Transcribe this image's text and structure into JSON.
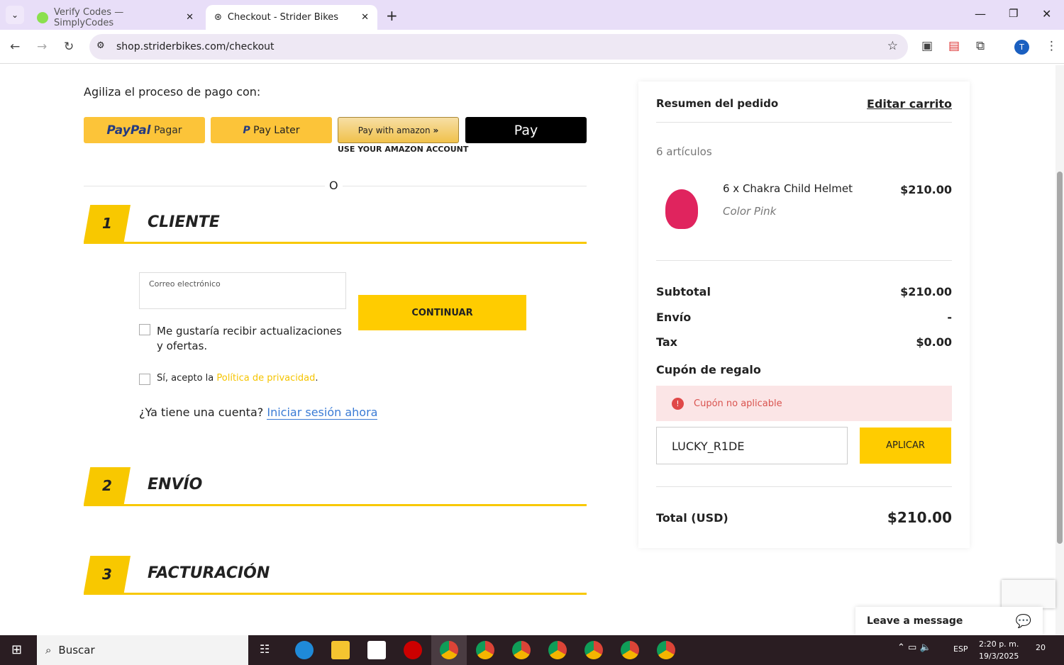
{
  "browser": {
    "tabs": [
      {
        "title": "Verify Codes — SimplyCodes"
      },
      {
        "title": "Checkout - Strider Bikes"
      }
    ],
    "url": "shop.striderbikes.com/checkout",
    "profile": "T"
  },
  "express": {
    "heading": "Agiliza el proceso de pago con:",
    "paypal_brand": "PayPal",
    "paypal_label": "Pagar",
    "paylater": "Pay Later",
    "amazon": "Pay with amazon",
    "amazon_sub": "USE YOUR AMAZON ACCOUNT",
    "applepay": " Pay",
    "or": "O"
  },
  "sections": [
    {
      "num": "1",
      "title": "CLIENTE"
    },
    {
      "num": "2",
      "title": "ENVÍO"
    },
    {
      "num": "3",
      "title": "FACTURACIÓN"
    }
  ],
  "customer": {
    "email_label": "Correo electrónico",
    "continue": "CONTINUAR",
    "newsletter": "Me gustaría recibir actualizaciones y ofertas.",
    "privacy_pre": "Sí, acepto la ",
    "privacy_link": "Política de privacidad",
    "privacy_post": ".",
    "account_q": "¿Ya tiene una cuenta?",
    "login": "Iniciar sesión ahora"
  },
  "summary": {
    "title": "Resumen del pedido",
    "edit": "Editar carrito",
    "count": "6 artículos",
    "item": {
      "name": "6 x Chakra Child Helmet",
      "variant": "Color Pink",
      "price": "$210.00"
    },
    "subtotal_l": "Subtotal",
    "subtotal": "$210.00",
    "shipping_l": "Envío",
    "shipping": "-",
    "tax_l": "Tax",
    "tax": "$0.00",
    "coupon_l": "Cupón de regalo",
    "coupon_error": "Cupón no aplicable",
    "coupon_value": "LUCKY_R1DE",
    "apply": "APLICAR",
    "total_l": "Total (USD)",
    "total": "$210.00"
  },
  "chat": {
    "label": "Leave a message"
  },
  "taskbar": {
    "search": "Buscar",
    "lang": "ESP",
    "time": "2:20 p. m.",
    "date": "19/3/2025",
    "notif": "20"
  }
}
